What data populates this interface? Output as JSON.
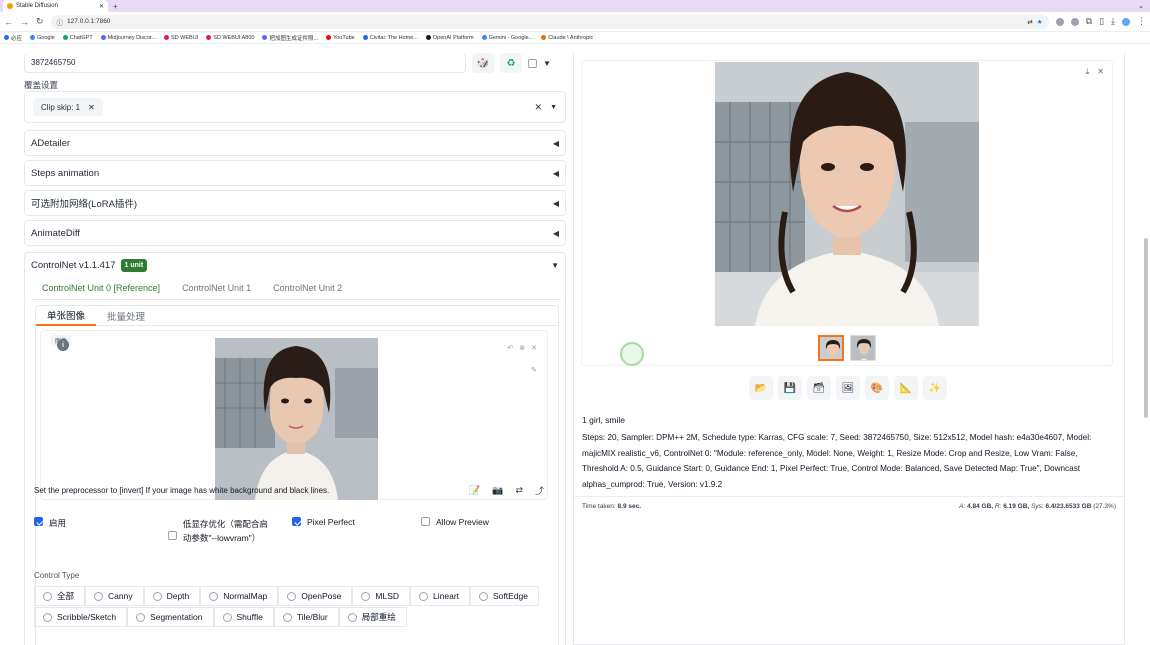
{
  "browser": {
    "tab_title": "Stable Diffusion",
    "url": "127.0.0.1:7860",
    "bookmarks": [
      "必应",
      "Google",
      "ChatGPT",
      "Midjourney Discor...",
      "SD WEBUI",
      "SD WEBUI A800",
      "把加图生成证件照...",
      "YouTube",
      "Civitai: The Home...",
      "OpenAI Platform",
      "Gemini - Google...",
      "Claude \\ Anthropic"
    ]
  },
  "left": {
    "seed_value": "3872465750",
    "override_label": "覆盖设置",
    "override_chip": "Clip skip: 1",
    "accordions": [
      "ADetailer",
      "Steps animation",
      "可选附加网络(LoRA插件)",
      "AnimateDiff"
    ],
    "controlnet": {
      "title": "ControlNet v1.1.417",
      "badge": "1 unit",
      "unit_tabs": [
        "ControlNet Unit 0 [Reference]",
        "ControlNet Unit 1",
        "ControlNet Unit 2"
      ],
      "sub_tabs": [
        "单张图像",
        "批量处理"
      ],
      "image_label": "图像",
      "hint": "Set the preprocessor to [invert] If your image has white background and black lines.",
      "options": {
        "enable": "启用",
        "lowvram": "低显存优化（需配合启动参数\"--lowvram\"）",
        "pixel_perfect": "Pixel Perfect",
        "allow_preview": "Allow Preview"
      },
      "control_type_label": "Control Type",
      "control_types": [
        "全部",
        "Canny",
        "Depth",
        "NormalMap",
        "OpenPose",
        "MLSD",
        "Lineart",
        "SoftEdge",
        "Scribble/Sketch",
        "Segmentation",
        "Shuffle",
        "Tile/Blur",
        "局部重绘"
      ]
    }
  },
  "right": {
    "prompt": "1 girl, smile",
    "params": "Steps: 20, Sampler: DPM++ 2M, Schedule type: Karras, CFG scale: 7, Seed: 3872465750, Size: 512x512, Model hash: e4a30e4607, Model: majicMIX realistic_v6, ControlNet 0: \"Module: reference_only, Model: None, Weight: 1, Resize Mode: Crop and Resize, Low Vram: False, Threshold A: 0.5, Guidance Start: 0, Guidance End: 1, Pixel Perfect: True, Control Mode: Balanced, Save Detected Map: True\", Downcast alphas_cumprod: True, Version: v1.9.2",
    "time_label": "Time taken:",
    "time_value": "8.9 sec.",
    "vram_a_label": "A:",
    "vram_a": "4.84 GB,",
    "vram_r_label": "R:",
    "vram_r": "6.19 GB,",
    "vram_sys_label": "Sys:",
    "vram_sys": "6.4/23.6533 GB",
    "vram_pct": "(27.3%)"
  }
}
